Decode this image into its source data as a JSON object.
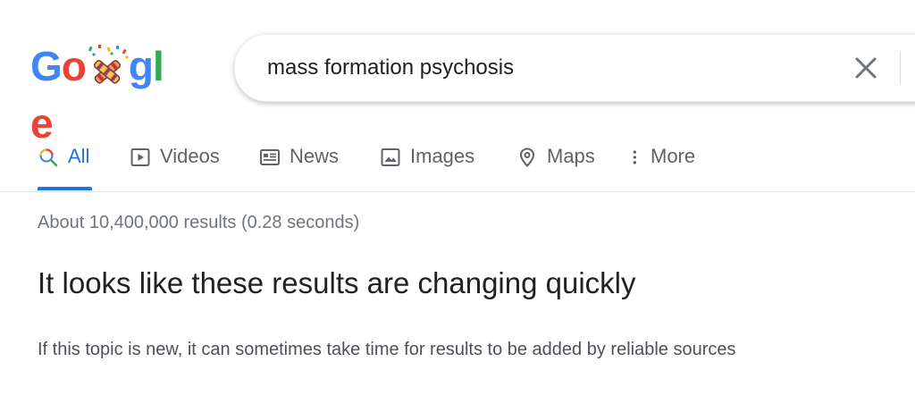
{
  "logo": {
    "text": "Google",
    "letters": [
      "G",
      "o",
      "",
      "g",
      "l",
      "e"
    ],
    "colors": [
      "#4285F4",
      "#EA4335",
      "#FBBC05",
      "#4285F4",
      "#34A853",
      "#EA4335"
    ]
  },
  "search": {
    "query": "mass formation psychosis",
    "clear_icon": "close-icon"
  },
  "tabs": [
    {
      "label": "All",
      "icon": "search-icon",
      "active": true
    },
    {
      "label": "Videos",
      "icon": "play-icon",
      "active": false
    },
    {
      "label": "News",
      "icon": "newspaper-icon",
      "active": false
    },
    {
      "label": "Images",
      "icon": "image-icon",
      "active": false
    },
    {
      "label": "Maps",
      "icon": "map-pin-icon",
      "active": false
    },
    {
      "label": "More",
      "icon": "more-vert-icon",
      "active": false
    }
  ],
  "results": {
    "stats": "About 10,400,000 results (0.28 seconds)",
    "notice_title": "It looks like these results are changing quickly",
    "notice_body": "If this topic is new, it can sometimes take time for results to be added by reliable sources"
  },
  "colors": {
    "accent": "#1a73e8",
    "text_primary": "#202124",
    "text_secondary": "#5f6368",
    "text_muted": "#70757a"
  }
}
